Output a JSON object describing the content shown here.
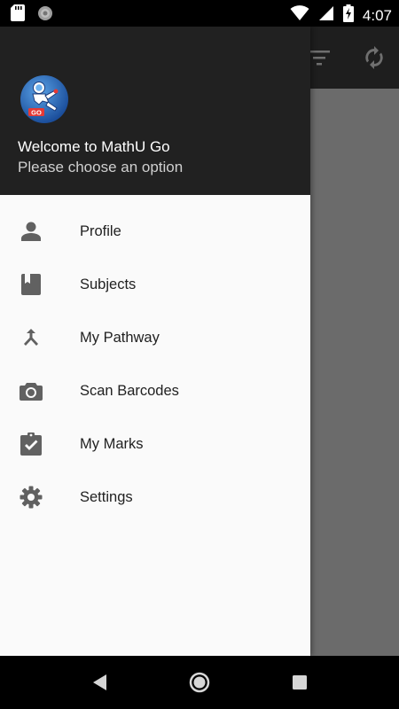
{
  "status_bar": {
    "time": "4:07",
    "left_icons": [
      "sd-card-icon",
      "sync-circle-icon"
    ],
    "right_icons": [
      "wifi-icon",
      "cellular-signal-icon",
      "battery-charging-icon"
    ]
  },
  "background_app": {
    "toolbar_actions": [
      "filter-icon",
      "refresh-icon"
    ],
    "toolbar_color": "#1e1e1e",
    "scrim_color": "#6b6b6b"
  },
  "drawer": {
    "header": {
      "logo": "mathu-go-logo",
      "logo_text": "GO",
      "title": "Welcome to MathU Go",
      "subtitle": "Please choose an option",
      "background": "#212121"
    },
    "items": [
      {
        "label": "Profile",
        "icon": "person-icon"
      },
      {
        "label": "Subjects",
        "icon": "book-icon"
      },
      {
        "label": "My Pathway",
        "icon": "merge-arrow-icon"
      },
      {
        "label": "Scan Barcodes",
        "icon": "camera-icon"
      },
      {
        "label": "My Marks",
        "icon": "clipboard-check-icon"
      },
      {
        "label": "Settings",
        "icon": "gear-icon"
      }
    ],
    "icon_color": "#616161",
    "background": "#fafafa"
  },
  "nav_bar": {
    "buttons": [
      "back-button",
      "home-button",
      "recents-button"
    ]
  }
}
